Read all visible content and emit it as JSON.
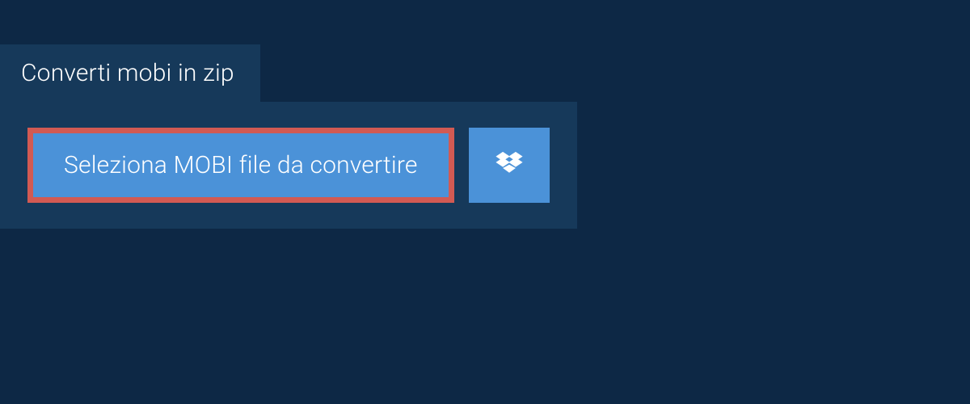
{
  "tab": {
    "title": "Converti mobi in zip"
  },
  "panel": {
    "select_button_label": "Seleziona MOBI file da convertire",
    "dropbox_icon": "dropbox"
  },
  "colors": {
    "page_bg": "#0d2845",
    "panel_bg": "#16395a",
    "button_bg": "#4b92d8",
    "highlight_border": "#d25a53"
  }
}
